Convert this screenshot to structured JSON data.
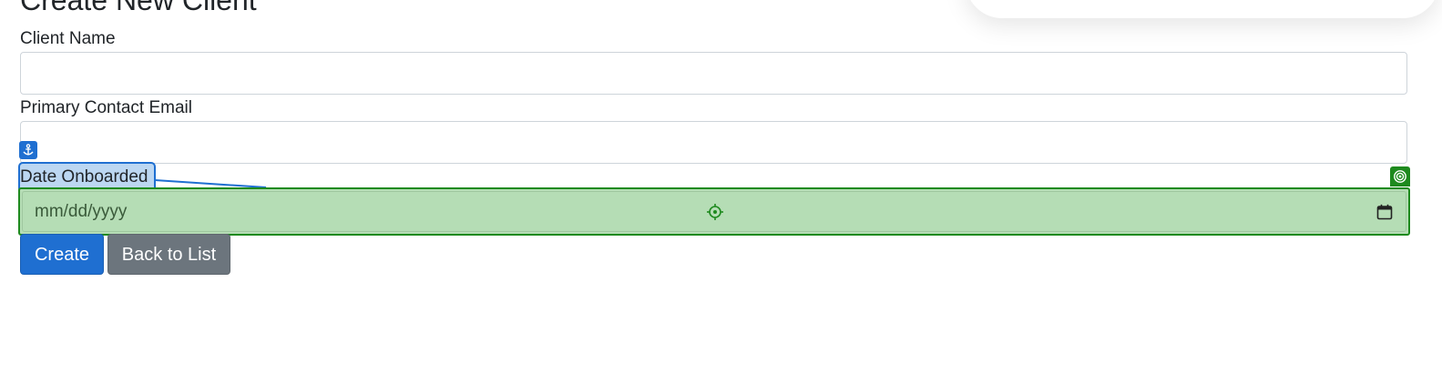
{
  "page": {
    "title": "Create New Client"
  },
  "form": {
    "client_name": {
      "label": "Client Name",
      "value": ""
    },
    "primary_contact_email": {
      "label": "Primary Contact Email",
      "value": ""
    },
    "date_onboarded": {
      "label": "Date Onboarded",
      "placeholder": "mm/dd/yyyy"
    }
  },
  "buttons": {
    "create": "Create",
    "back_to_list": "Back to List"
  },
  "overlay": {
    "anchor_icon": "anchor-icon",
    "target_icon": "crosshair-icon",
    "target_badge_icon": "target-icon",
    "anchor_color": "#1f6fd1",
    "target_color": "#1e8a1e",
    "target_fill": "#b5ddb5",
    "anchor_fill": "#bcd7f2"
  },
  "colors": {
    "primary": "#1f6fd1",
    "secondary": "#6c757d",
    "text": "#212529",
    "border": "#ced4da"
  }
}
